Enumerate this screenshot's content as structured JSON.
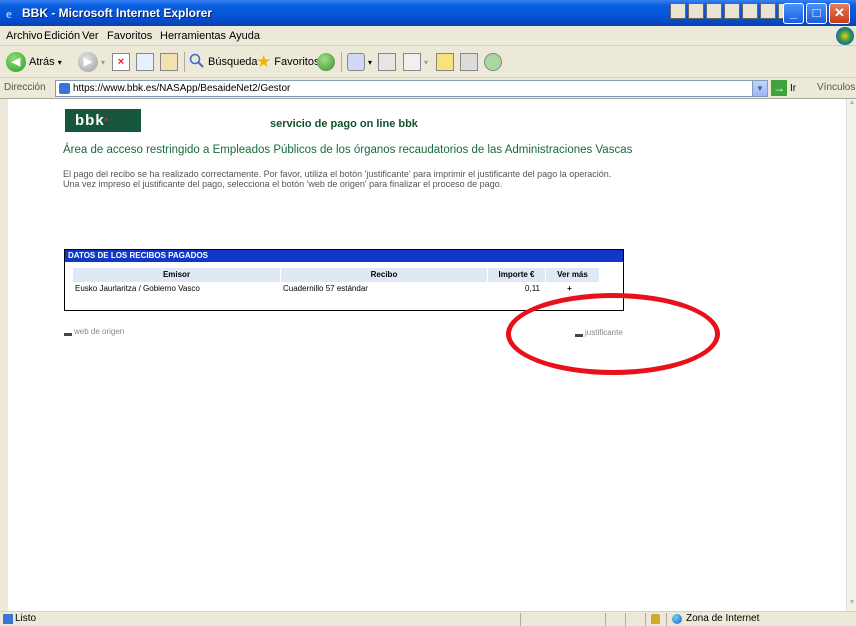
{
  "window": {
    "title": "BBK - Microsoft Internet Explorer",
    "controls": [
      "minimize",
      "maximize",
      "close"
    ]
  },
  "menubar": {
    "items": [
      "Archivo",
      "Edición",
      "Ver",
      "Favoritos",
      "Herramientas",
      "Ayuda"
    ]
  },
  "toolbar": {
    "back_label": "Atrás",
    "search_label": "Búsqueda",
    "favorites_label": "Favoritos"
  },
  "addressbar": {
    "label": "Dirección",
    "url": "https://www.bbk.es/NASApp/BesaideNet2/Gestor",
    "go_label": "Ir",
    "links_label": "Vínculos"
  },
  "page": {
    "logo": "bbk",
    "service_title": "servicio de pago on line bbk",
    "restricted_notice": "Área de acceso restringido a Empleados Públicos de los órganos recaudatorios de las Administraciones Vascas",
    "message": "El pago del recibo se ha realizado correctamente. Por favor, utiliza el botón 'justificante' para imprimir el justificante del pago la operación. Una vez impreso el justificante del pago, selecciona el botón 'web de origen' para finalizar el proceso de pago.",
    "panel": {
      "title": "DATOS DE LOS RECIBOS PAGADOS",
      "columns": [
        "Emisor",
        "Recibo",
        "Importe €",
        "Ver más"
      ],
      "rows": [
        {
          "emisor": "Eusko Jaurlaritza / Gobierno Vasco",
          "recibo": "Cuadernillo 57 estándar",
          "importe": "0,11",
          "ver_mas": "+"
        }
      ]
    },
    "back_link": "web de origen",
    "print_link": "justificante"
  },
  "annotation": {
    "color": "#e8101a",
    "shape": "ellipse",
    "target": "justificante"
  },
  "statusbar": {
    "status": "Listo",
    "zone": "Zona de Internet"
  },
  "colors": {
    "brand_green": "#16563a",
    "panel_header": "#1037c7",
    "column_header_bg": "#dfe9f5"
  }
}
